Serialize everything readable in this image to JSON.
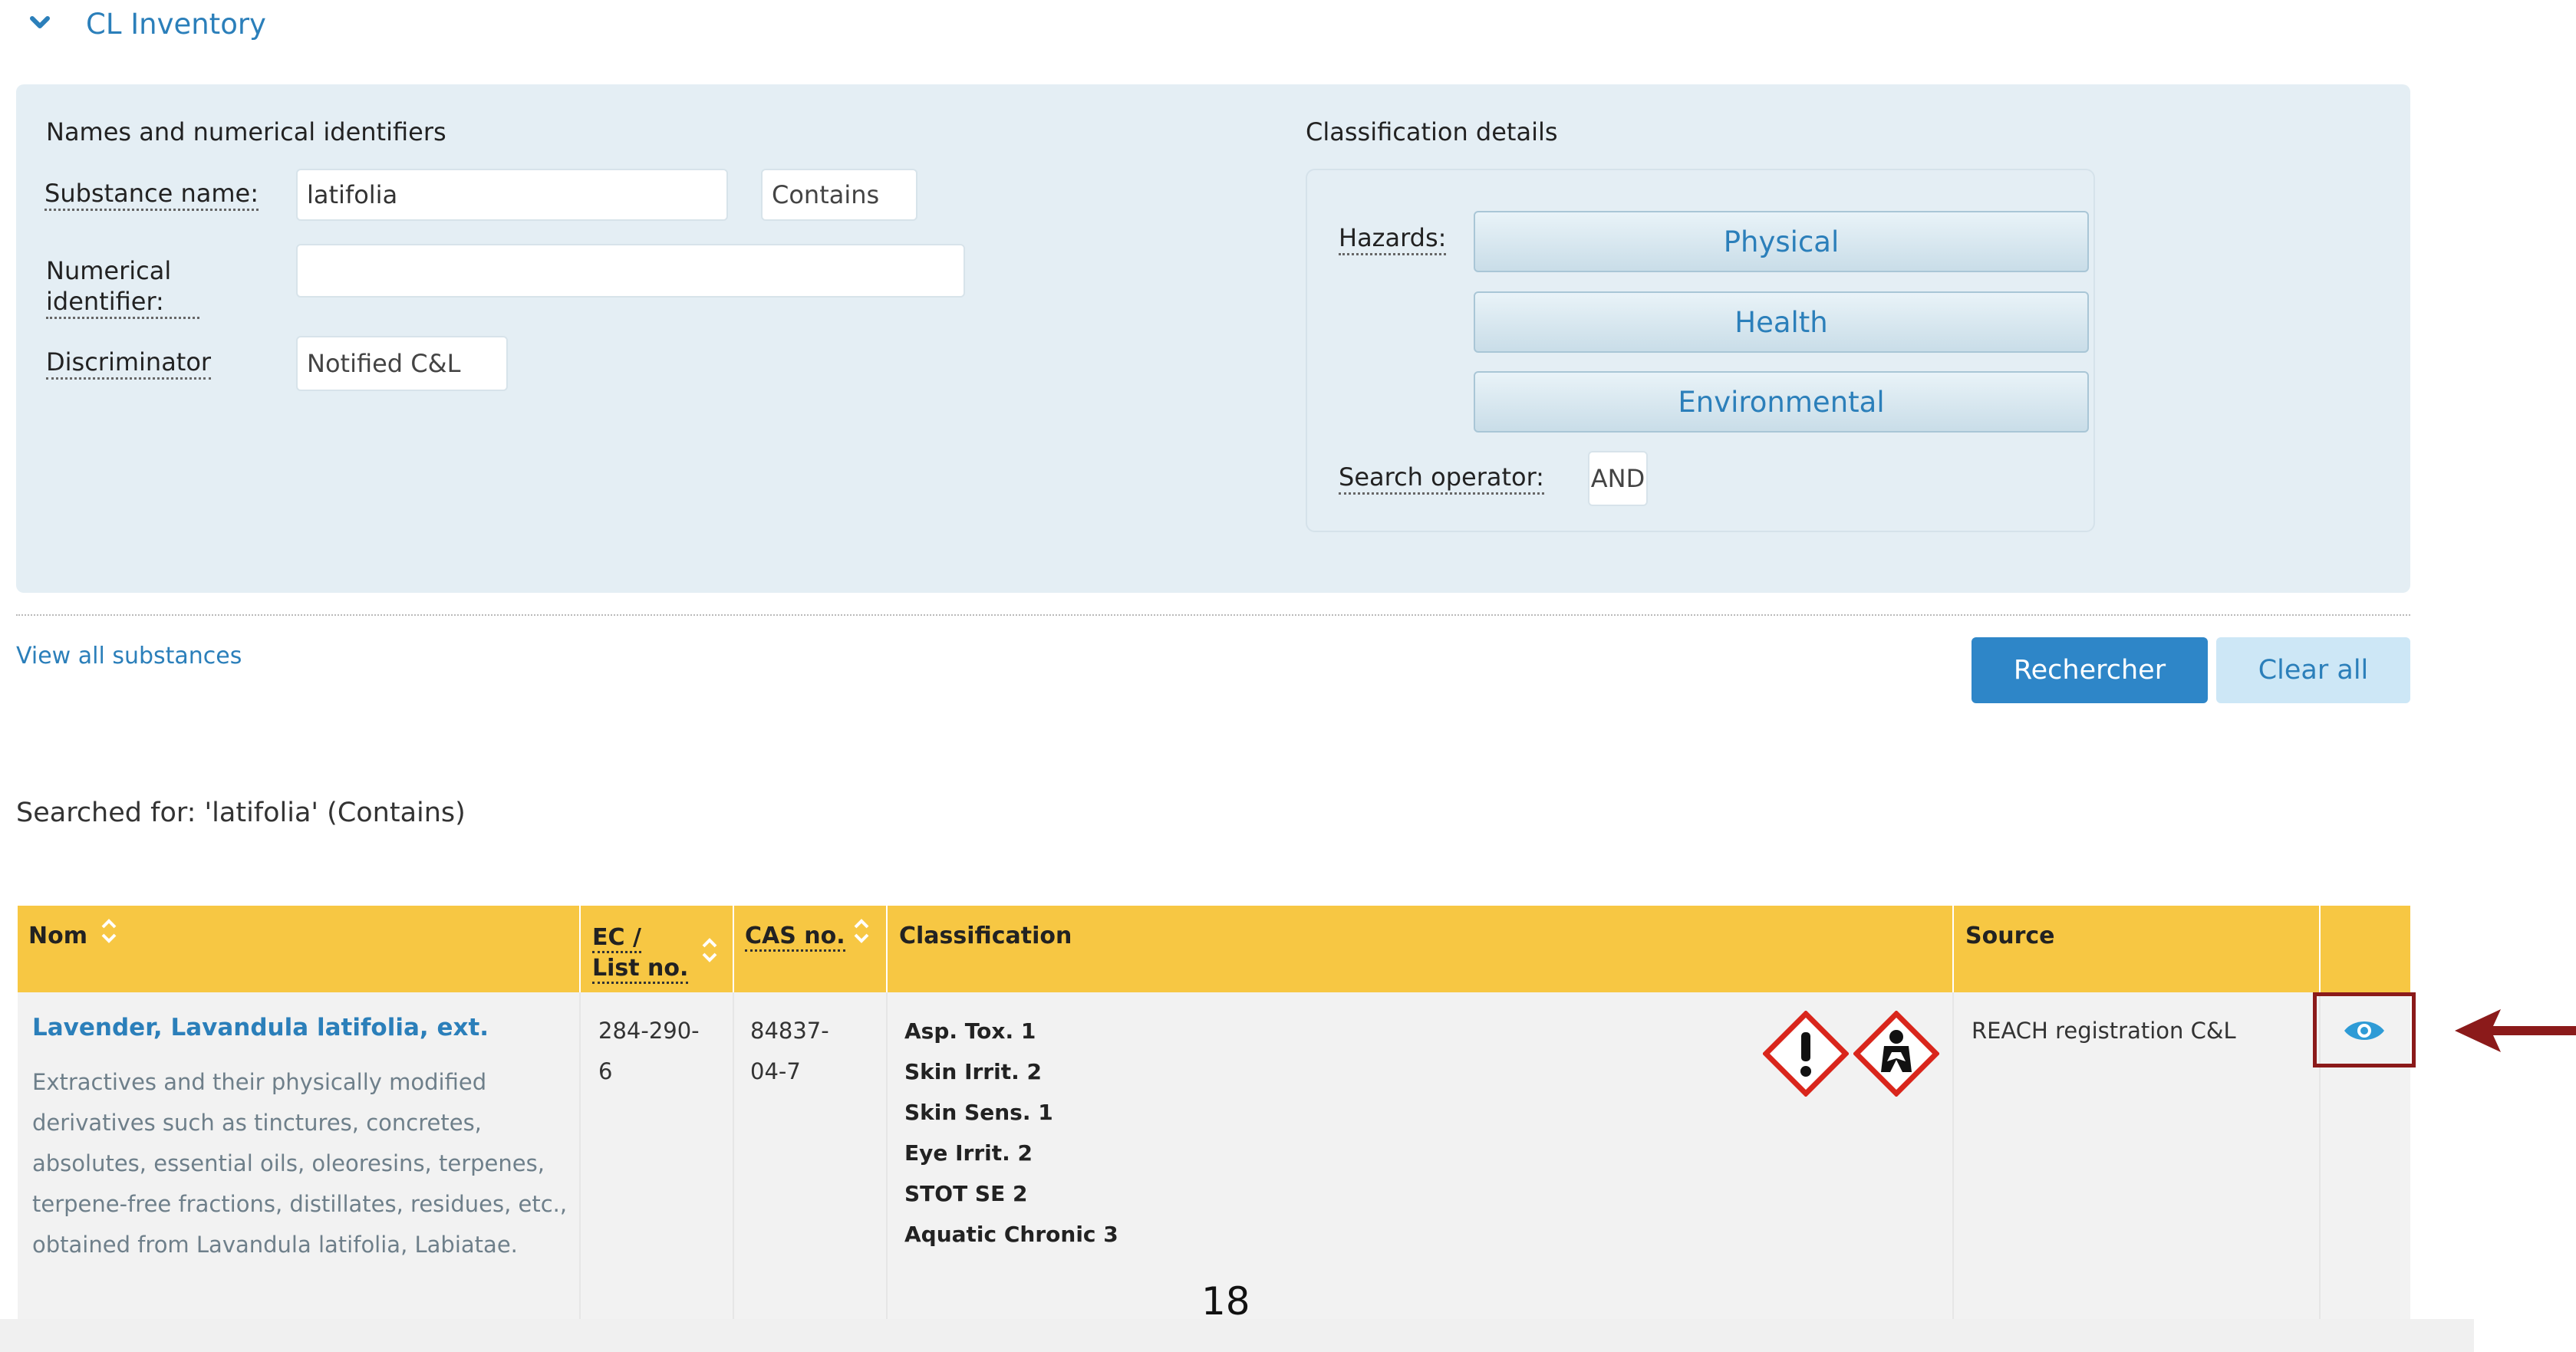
{
  "header": {
    "title": "CL Inventory"
  },
  "names_section": {
    "title": "Names and numerical identifiers",
    "substance_label": "Substance name:",
    "substance_value": "latifolia",
    "match_mode": "Contains",
    "numerical_label": "Numerical identifier:",
    "numerical_value": "",
    "discriminator_label": "Discriminator",
    "discriminator_value": "Notified C&L"
  },
  "classification_section": {
    "title": "Classification details",
    "hazards_label": "Hazards:",
    "hazard_buttons": [
      "Physical",
      "Health",
      "Environmental"
    ],
    "operator_label": "Search operator:",
    "operator_value": "AND"
  },
  "actions": {
    "view_all": "View all substances",
    "search": "Rechercher",
    "clear": "Clear all"
  },
  "searched_for": "Searched for: 'latifolia' (Contains)",
  "table": {
    "headers": {
      "name": "Nom",
      "ec_line1": "EC /",
      "ec_line2": "List no.",
      "cas": "CAS no.",
      "classification": "Classification",
      "source": "Source"
    },
    "row": {
      "name": "Lavender, Lavandula latifolia, ext.",
      "description": "Extractives and their physically modified derivatives such as tinctures, concretes, absolutes, essential oils, oleoresins, terpenes, terpene-free fractions, distillates, residues, etc., obtained from Lavandula latifolia, Labiatae.",
      "ec_line1": "284-290-",
      "ec_line2": "6",
      "cas_line1": "84837-",
      "cas_line2": "04-7",
      "classification": [
        "Asp. Tox. 1",
        "Skin Irrit. 2",
        "Skin Sens. 1",
        "Eye Irrit. 2",
        "STOT SE 2",
        "Aquatic Chronic 3"
      ],
      "pictograms": [
        "exclamation-mark-pictogram-icon",
        "health-hazard-pictogram-icon"
      ],
      "source": "REACH registration C&L"
    }
  },
  "page_number": "18",
  "colors": {
    "accent": "#2b7fba",
    "table_header": "#f7c743",
    "panel": "#e4eef4",
    "highlight": "#8b1a1a",
    "hazard_red": "#d9261c"
  }
}
